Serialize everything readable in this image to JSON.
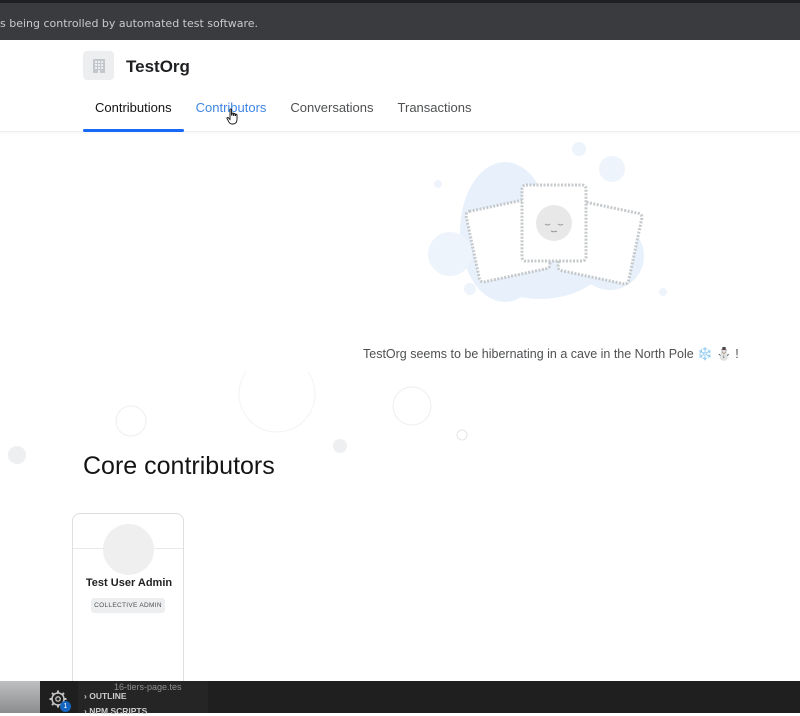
{
  "infobar": {
    "text": "s being controlled by automated test software."
  },
  "org": {
    "name": "TestOrg"
  },
  "tabs": [
    {
      "label": "Contributions"
    },
    {
      "label": "Contributors"
    },
    {
      "label": "Conversations"
    },
    {
      "label": "Transactions"
    }
  ],
  "empty_state": {
    "message": "TestOrg seems to be hibernating in a cave in the North Pole ❄️ ⛄ !"
  },
  "core_contributors": {
    "title": "Core contributors",
    "members": [
      {
        "name": "Test User Admin",
        "role": "COLLECTIVE ADMIN"
      }
    ]
  },
  "taskbar": {
    "outline_label": "OUTLINE",
    "file_label": "16-tiers-page.tes",
    "npm_label": "NPM SCRIPTS",
    "badge_count": "1"
  },
  "colors": {
    "accent": "#1869f5",
    "hover_tab": "#3f86e5",
    "snow": "#e8f1fb"
  }
}
